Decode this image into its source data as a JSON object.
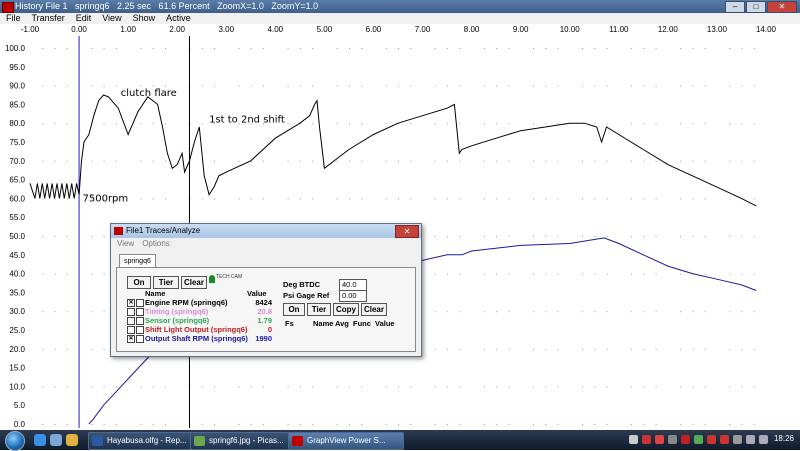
{
  "window": {
    "title": "History File 1   springq6   2.25 sec   61.6 Percent   ZoomX=1.0   ZoomY=1.0",
    "minimize_glyph": "–",
    "maximize_glyph": "□",
    "close_glyph": "✕"
  },
  "menu": [
    "File",
    "Transfer",
    "Edit",
    "View",
    "Show",
    "Active"
  ],
  "chart_data": {
    "type": "line",
    "x_ticks": [
      "-1.00",
      "0.00",
      "1.00",
      "2.00",
      "3.00",
      "4.00",
      "5.00",
      "6.00",
      "7.00",
      "8.00",
      "9.00",
      "10.00",
      "11.00",
      "12.00",
      "13.00",
      "14.00"
    ],
    "y_ticks": [
      "0.0",
      "5.0",
      "10.0",
      "15.0",
      "20.0",
      "25.0",
      "30.0",
      "35.0",
      "40.0",
      "45.0",
      "50.0",
      "55.0",
      "60.0",
      "65.0",
      "70.0",
      "75.0",
      "80.0",
      "85.0",
      "90.0",
      "95.0",
      "100.0"
    ],
    "xlim": [
      -1.0,
      14.0
    ],
    "ylim": [
      0,
      100
    ],
    "cursor_x": [
      0.0,
      2.25
    ],
    "annotations": [
      {
        "text": "clutch flare",
        "x": 0.85,
        "y": 88.0
      },
      {
        "text": "1st to 2nd shift",
        "x": 2.65,
        "y": 81.0
      },
      {
        "text": "7500rpm",
        "x": 0.07,
        "y": 60.0
      }
    ],
    "series": [
      {
        "color": "#000000",
        "x": [
          -1.0,
          -0.9,
          -0.85,
          -0.8,
          -0.75,
          -0.7,
          -0.65,
          -0.6,
          -0.55,
          -0.5,
          -0.45,
          -0.4,
          -0.35,
          -0.3,
          -0.25,
          -0.2,
          -0.15,
          -0.1,
          -0.05,
          0.0,
          0.05,
          0.1,
          0.2,
          0.3,
          0.4,
          0.5,
          0.6,
          0.8,
          1.0,
          1.2,
          1.4,
          1.6,
          1.7,
          1.8,
          1.9,
          2.0,
          2.1,
          2.15,
          2.25,
          2.35,
          2.45,
          2.55,
          2.65,
          2.75,
          2.85,
          3.0,
          3.5,
          4.0,
          4.5,
          4.7,
          4.8,
          4.85,
          4.9,
          5.0,
          5.5,
          6.0,
          6.5,
          7.0,
          7.5,
          7.65,
          7.75,
          7.8,
          8.0,
          8.5,
          9.0,
          9.5,
          10.0,
          10.3,
          10.55,
          10.65,
          10.75,
          11.0,
          11.5,
          12.0,
          12.5,
          13.0,
          13.5,
          13.8
        ],
        "y": [
          64.0,
          60.0,
          64.0,
          60.0,
          64.0,
          60.0,
          64.0,
          60.0,
          64.0,
          60.0,
          64.0,
          60.0,
          64.0,
          60.0,
          64.0,
          60.0,
          64.0,
          60.0,
          64.0,
          61.0,
          70.0,
          75.0,
          77.0,
          82.0,
          86.0,
          87.5,
          87.0,
          84.0,
          77.0,
          83.0,
          87.0,
          85.0,
          79.0,
          72.0,
          68.0,
          69.0,
          72.0,
          67.0,
          70.0,
          75.0,
          79.0,
          66.0,
          61.0,
          63.0,
          66.0,
          67.0,
          70.0,
          76.0,
          80.0,
          82.0,
          85.0,
          86.0,
          79.0,
          68.0,
          73.0,
          77.0,
          80.0,
          82.0,
          84.0,
          85.0,
          72.0,
          73.0,
          74.0,
          76.0,
          78.0,
          79.0,
          80.0,
          80.0,
          79.0,
          75.0,
          79.0,
          77.0,
          73.0,
          69.0,
          66.0,
          63.0,
          60.0,
          58.0
        ]
      },
      {
        "color": "#1a1aa0",
        "x": [
          0.2,
          0.3,
          0.5,
          1.0,
          1.5,
          2.0,
          2.5,
          3.0,
          3.5,
          4.0,
          5.0,
          5.5,
          6.0,
          6.5,
          7.0,
          7.5,
          7.8,
          8.0,
          9.0,
          10.0,
          10.7,
          11.0,
          11.5,
          12.0,
          12.5,
          13.0,
          13.5,
          13.8
        ],
        "y": [
          0.0,
          1.5,
          5.0,
          12.0,
          19.0,
          25.0,
          32.0,
          38.0,
          40.5,
          42.0,
          42.0,
          43.0,
          42.5,
          42.0,
          43.5,
          45.0,
          45.0,
          46.0,
          47.5,
          48.0,
          49.5,
          48.0,
          45.0,
          42.0,
          40.0,
          38.5,
          37.0,
          35.5
        ]
      }
    ]
  },
  "dialog": {
    "title": "File1 Traces/Analyze",
    "menu": [
      "View",
      "Options"
    ],
    "tab": "springq6",
    "logo_text": "TECH CAM",
    "left_buttons": [
      "On",
      "Tier",
      "Clear"
    ],
    "name_header": "Name",
    "value_header": "Value",
    "traces": [
      {
        "name": "Engine RPM (springq6)",
        "value": "8424",
        "color": "#000000",
        "checked": true
      },
      {
        "name": "Timing (springq6)",
        "value": "20.8",
        "color": "#d98ad9",
        "checked": false
      },
      {
        "name": "Sensor (springq6)",
        "value": "1.79",
        "color": "#2fa84f",
        "checked": false
      },
      {
        "name": "Shift Light Output (springq6)",
        "value": "0",
        "color": "#c02020",
        "checked": false
      },
      {
        "name": "Output Shaft RPM (springq6)",
        "value": "1990",
        "color": "#1a1aa0",
        "checked": true
      }
    ],
    "deg_btdc_label": "Deg BTDC",
    "deg_btdc_value": "40.0",
    "psi_label": "Psi Gage Ref",
    "psi_value": "0.00",
    "right_buttons": [
      "On",
      "Tier",
      "Copy",
      "Clear"
    ],
    "fs_headers": [
      "Fs",
      "Name",
      "Avg",
      "Func",
      "Value"
    ]
  },
  "taskbar": {
    "tasks": [
      "Hayabusa.olfg - Rep...",
      "springf6.jpg - Picas...",
      "GraphView Power S..."
    ],
    "clock": "18:26"
  }
}
